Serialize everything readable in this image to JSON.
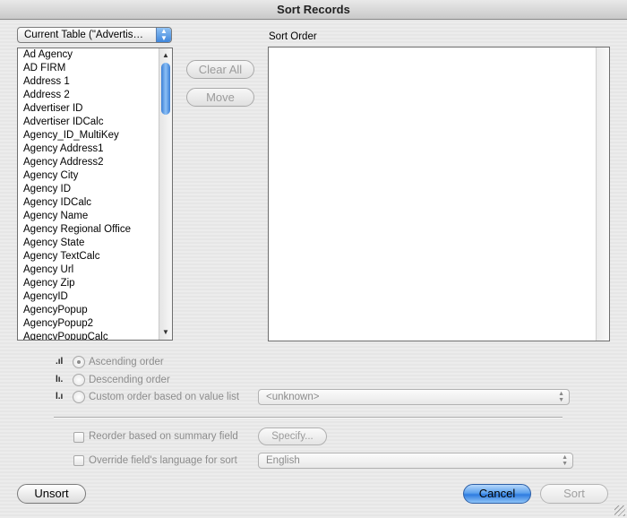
{
  "window": {
    "title": "Sort Records"
  },
  "table_selector": {
    "value": "Current Table (\"Advertis…"
  },
  "fields": [
    "Ad Agency",
    "AD FIRM",
    "Address 1",
    "Address 2",
    "Advertiser ID",
    "Advertiser IDCalc",
    "Agency_ID_MultiKey",
    "Agency Address1",
    "Agency Address2",
    "Agency City",
    "Agency ID",
    "Agency IDCalc",
    "Agency Name",
    "Agency Regional Office",
    "Agency State",
    "Agency TextCalc",
    "Agency Url",
    "Agency Zip",
    "AgencyID",
    "AgencyPopup",
    "AgencyPopup2",
    "AgencyPopupCalc"
  ],
  "buttons": {
    "clear_all": "Clear All",
    "move": "Move",
    "specify": "Specify...",
    "unsort": "Unsort",
    "cancel": "Cancel",
    "sort": "Sort"
  },
  "sort_order": {
    "label": "Sort Order"
  },
  "order_options": {
    "ascending": "Ascending order",
    "descending": "Descending order",
    "custom": "Custom order based on value list",
    "selected": "ascending"
  },
  "value_list": {
    "value": "<unknown>"
  },
  "summary": {
    "label": "Reorder based on summary field",
    "checked": false
  },
  "language": {
    "label": "Override field's language for sort",
    "value": "English",
    "checked": false
  },
  "colors": {
    "default_button": "#2f7ce0",
    "disabled_text": "#8c8c8c"
  }
}
